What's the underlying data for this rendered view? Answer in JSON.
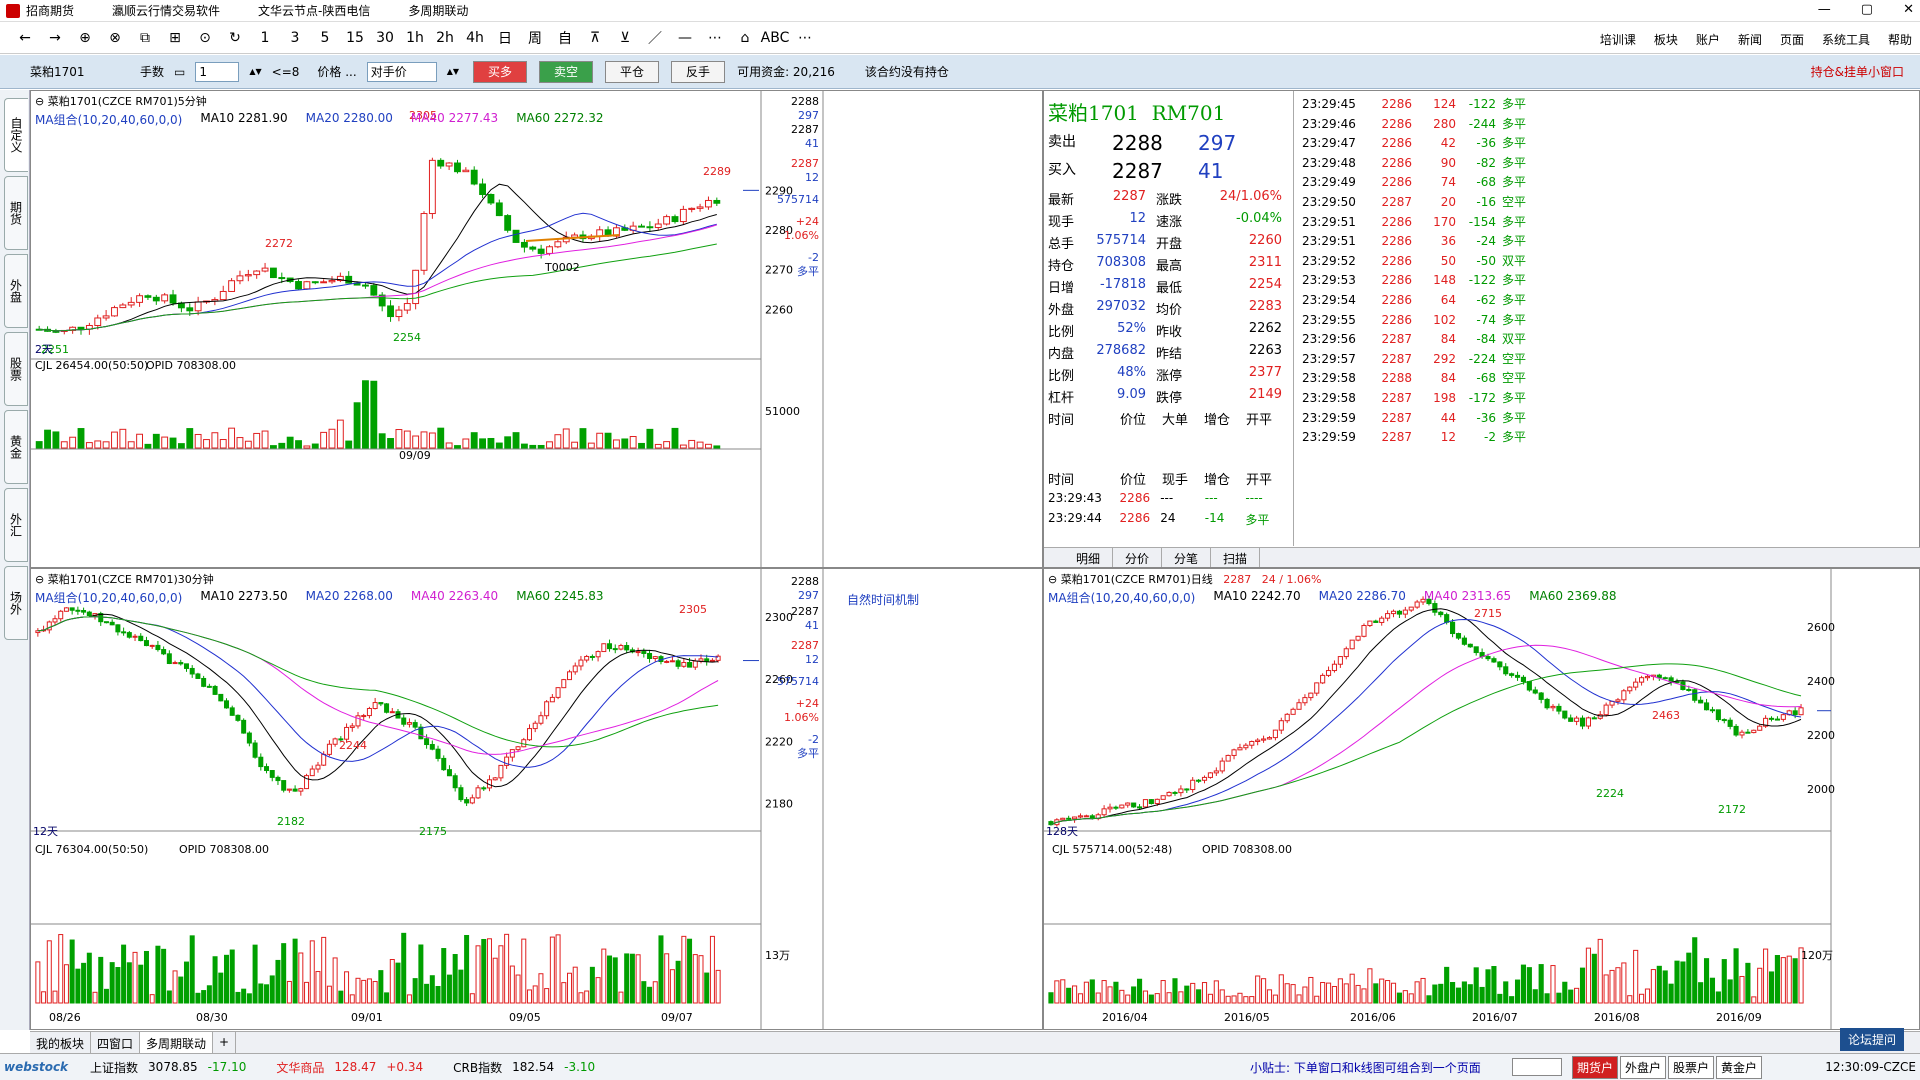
{
  "titlebar": {
    "items": [
      "招商期货",
      "瀛顺云行情交易软件",
      "文华云节点-陕西电信",
      "多周期联动"
    ],
    "controls": [
      "—",
      "▢",
      "✕"
    ]
  },
  "toolbar": {
    "buttons": [
      "←",
      "→",
      "⊕",
      "⊗",
      "⧉",
      "⊞",
      "⊙",
      "↻",
      "1",
      "3",
      "5",
      "15",
      "30",
      "1h",
      "2h",
      "4h",
      "日",
      "周",
      "自",
      "⊼",
      "⊻",
      "／",
      "—",
      "⋯",
      "⌂",
      "ABC",
      "⋯"
    ],
    "right_menu": [
      "培训课",
      "板块",
      "账户",
      "新闻",
      "页面",
      "系统工具",
      "帮助"
    ]
  },
  "order": {
    "contract": "菜粕1701",
    "qty_label": "手数",
    "qty_value": "1",
    "qty_limit": "<=8",
    "price_label": "价格 ...",
    "price_mode": "对手价",
    "buy": "买多",
    "sell": "卖空",
    "close": "平仓",
    "reverse": "反手",
    "funds": "可用资金: 20,216",
    "no_position": "该合约没有持仓",
    "right": "持仓&挂单小窗口"
  },
  "lefttabs": [
    "自定义",
    "期货",
    "外盘",
    "股票",
    "黄金",
    "外汇",
    "场外"
  ],
  "panel1": {
    "title": "菜粕1701(CZCE RM701)5分钟",
    "ma": [
      "MA组合(10,20,40,60,0,0)",
      "MA10 2281.90",
      "MA20 2280.00",
      "MA40 2277.43",
      "MA60 2272.32"
    ],
    "vol_title": [
      "CJL 26454.00(50:50)",
      "OPID 708308.00"
    ],
    "labels": {
      "hi": "2305",
      "mid": "2289",
      "l1": "2272",
      "lo": "2254",
      "l2": "2251",
      "tag": "T0002",
      "date": "09/09",
      "days": "2天"
    },
    "axis": [
      "2290",
      "2280",
      "2270",
      "2260",
      "51000"
    ],
    "side": [
      "2288",
      "297",
      "2287",
      "41",
      "2287",
      "12",
      "575714",
      "+24",
      "1.06%",
      "-2",
      "多平"
    ]
  },
  "panel2": {
    "title": "菜粕1701(CZCE RM701)30分钟",
    "ma": [
      "MA组合(10,20,40,60,0,0)",
      "MA10 2273.50",
      "MA20 2268.00",
      "MA40 2263.40",
      "MA60 2245.83"
    ],
    "mech": "自然时间机制",
    "vol_title": [
      "CJL 76304.00(50:50)",
      "OPID 708308.00"
    ],
    "labels": {
      "hi": "2305",
      "l1": "2244",
      "lo": "2182",
      "lo2": "2175",
      "days": "12天"
    },
    "axis": [
      "2300",
      "2260",
      "2220",
      "2180",
      "13万"
    ],
    "dates": [
      "08/26",
      "08/30",
      "09/01",
      "09/05",
      "09/07"
    ],
    "side": [
      "2288",
      "297",
      "2287",
      "41",
      "2287",
      "12",
      "575714",
      "+24",
      "1.06%",
      "-2",
      "多平"
    ]
  },
  "panel3": {
    "title": "菜粕1701(CZCE RM701)日线",
    "price": "2287",
    "change": "24 / 1.06%",
    "ma": [
      "MA组合(10,20,40,60,0,0)",
      "MA10 2242.70",
      "MA20 2286.70",
      "MA40 2313.65",
      "MA60 2369.88"
    ],
    "vol_title": [
      "CJL 575714.00(52:48)",
      "OPID 708308.00"
    ],
    "labels": {
      "hi": "2715",
      "l1": "2463",
      "l2": "2224",
      "lo": "2172",
      "days": "128天"
    },
    "axis": [
      "2600",
      "2400",
      "2200",
      "2000",
      "120万"
    ],
    "dates": [
      "2016/04",
      "2016/05",
      "2016/06",
      "2016/07",
      "2016/08",
      "2016/09"
    ]
  },
  "quote": {
    "name": "菜粕1701",
    "code": "RM701",
    "ask_label": "卖出",
    "ask_price": "2288",
    "ask_vol": "297",
    "bid_label": "买入",
    "bid_price": "2287",
    "bid_vol": "41",
    "rows": [
      [
        "最新",
        "2287",
        "涨跌",
        "24/1.06%"
      ],
      [
        "现手",
        "12",
        "速涨",
        "-0.04%"
      ],
      [
        "总手",
        "575714",
        "开盘",
        "2260"
      ],
      [
        "持仓",
        "708308",
        "最高",
        "2311"
      ],
      [
        "日增",
        "-17818",
        "最低",
        "2254"
      ],
      [
        "外盘",
        "297032",
        "均价",
        "2283"
      ],
      [
        "比例",
        "52%",
        "昨收",
        "2262"
      ],
      [
        "内盘",
        "278682",
        "昨结",
        "2263"
      ],
      [
        "比例",
        "48%",
        "涨停",
        "2377"
      ],
      [
        "杠杆",
        "9.09",
        "跌停",
        "2149"
      ]
    ],
    "hdr1": [
      "时间",
      "价位",
      "大单",
      "增仓",
      "开平"
    ],
    "hdr2": [
      "时间",
      "价位",
      "现手",
      "增仓",
      "开平"
    ],
    "recent": [
      [
        "23:29:43",
        "2286",
        "---",
        "---",
        "----"
      ],
      [
        "23:29:44",
        "2286",
        "24",
        "-14",
        "多平"
      ]
    ],
    "trades": [
      [
        "23:29:45",
        "2286",
        "124",
        "-122",
        "多平"
      ],
      [
        "23:29:46",
        "2286",
        "280",
        "-244",
        "多平"
      ],
      [
        "23:29:47",
        "2286",
        "42",
        "-36",
        "多平"
      ],
      [
        "23:29:48",
        "2286",
        "90",
        "-82",
        "多平"
      ],
      [
        "23:29:49",
        "2286",
        "74",
        "-68",
        "多平"
      ],
      [
        "23:29:50",
        "2287",
        "20",
        "-16",
        "空平"
      ],
      [
        "23:29:51",
        "2286",
        "170",
        "-154",
        "多平"
      ],
      [
        "23:29:51",
        "2286",
        "36",
        "-24",
        "多平"
      ],
      [
        "23:29:52",
        "2286",
        "50",
        "-50",
        "双平"
      ],
      [
        "23:29:53",
        "2286",
        "148",
        "-122",
        "多平"
      ],
      [
        "23:29:54",
        "2286",
        "64",
        "-62",
        "多平"
      ],
      [
        "23:29:55",
        "2286",
        "102",
        "-74",
        "多平"
      ],
      [
        "23:29:56",
        "2287",
        "84",
        "-84",
        "双平"
      ],
      [
        "23:29:57",
        "2287",
        "292",
        "-224",
        "空平"
      ],
      [
        "23:29:58",
        "2288",
        "84",
        "-68",
        "空平"
      ],
      [
        "23:29:58",
        "2287",
        "198",
        "-172",
        "多平"
      ],
      [
        "23:29:59",
        "2287",
        "44",
        "-36",
        "多平"
      ],
      [
        "23:29:59",
        "2287",
        "12",
        "-2",
        "多平"
      ]
    ],
    "tabs": [
      "明细",
      "分价",
      "分笔",
      "扫描"
    ]
  },
  "bottomtabs": [
    "我的板块",
    "四窗口",
    "多周期联动",
    "+"
  ],
  "status": {
    "logo": "webstock",
    "idx1_name": "上证指数",
    "idx1_val": "3078.85",
    "idx1_chg": "-17.10",
    "idx2_name": "文华商品",
    "idx2_val": "128.47",
    "idx2_chg": "+0.34",
    "idx3_name": "CRB指数",
    "idx3_val": "182.54",
    "idx3_chg": "-3.10",
    "tip": "小贴士: 下单窗口和k线图可组合到一个页面",
    "accounts": [
      "期货户",
      "外盘户",
      "股票户",
      "黄金户"
    ],
    "forum": "论坛提问",
    "time": "12:30:09-CZCE"
  }
}
